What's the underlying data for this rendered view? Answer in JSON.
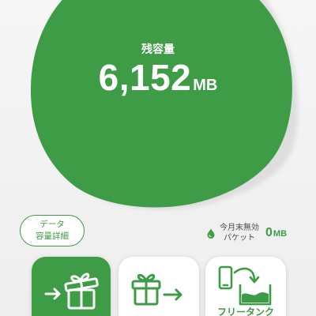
{
  "remaining": {
    "label": "残容量",
    "value": "6,152",
    "unit": "MB"
  },
  "detail_button": {
    "line1": "データ",
    "line2": "容量詳細"
  },
  "expiring": {
    "icon": "droplet-icon",
    "line1": "今月末無効",
    "line2": "パケット",
    "value": "0",
    "unit": "MB"
  },
  "actions": [
    {
      "icon": "gift-receive-icon",
      "selected": true
    },
    {
      "icon": "gift-send-icon",
      "selected": false
    },
    {
      "icon": "free-tank-icon",
      "label": "フリータンク",
      "selected": false
    }
  ],
  "colors": {
    "accent": "#3e9b46",
    "background": "#f2f2f2",
    "muted_text": "#4a4a4a",
    "tile": "#ffffff"
  }
}
